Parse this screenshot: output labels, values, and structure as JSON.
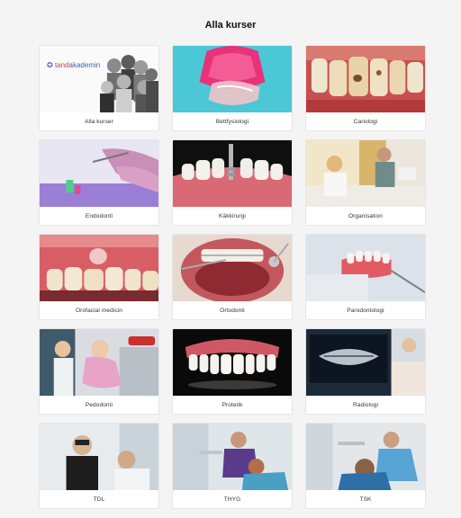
{
  "page": {
    "title": "Alla kurser"
  },
  "courses": [
    {
      "label": "Alla kurser",
      "image": "group-photo-logo"
    },
    {
      "label": "Bettfysiologi",
      "image": "night-guard-photo"
    },
    {
      "label": "Cariologi",
      "image": "decayed-teeth-photo"
    },
    {
      "label": "Endodonti",
      "image": "root-canal-photo"
    },
    {
      "label": "Käkkirurgi",
      "image": "dental-implant-photo"
    },
    {
      "label": "Organisation",
      "image": "reception-photo"
    },
    {
      "label": "Orofacial medicin",
      "image": "gum-lesion-photo"
    },
    {
      "label": "Ortodonti",
      "image": "braces-photo"
    },
    {
      "label": "Parodontologi",
      "image": "dental-model-photo"
    },
    {
      "label": "Pedodonti",
      "image": "child-patient-photo"
    },
    {
      "label": "Protetik",
      "image": "denture-photo"
    },
    {
      "label": "Radiologi",
      "image": "xray-photo"
    },
    {
      "label": "TDL",
      "image": "dentist-patient-photo"
    },
    {
      "label": "THYG",
      "image": "hygienist-photo"
    },
    {
      "label": "TSK",
      "image": "assistant-photo"
    }
  ],
  "logo": {
    "prefix": "tand",
    "suffix": "akademin"
  },
  "colors": {
    "background": "#f4f4f4",
    "card": "#ffffff",
    "logo_blue": "#3a63b8"
  }
}
